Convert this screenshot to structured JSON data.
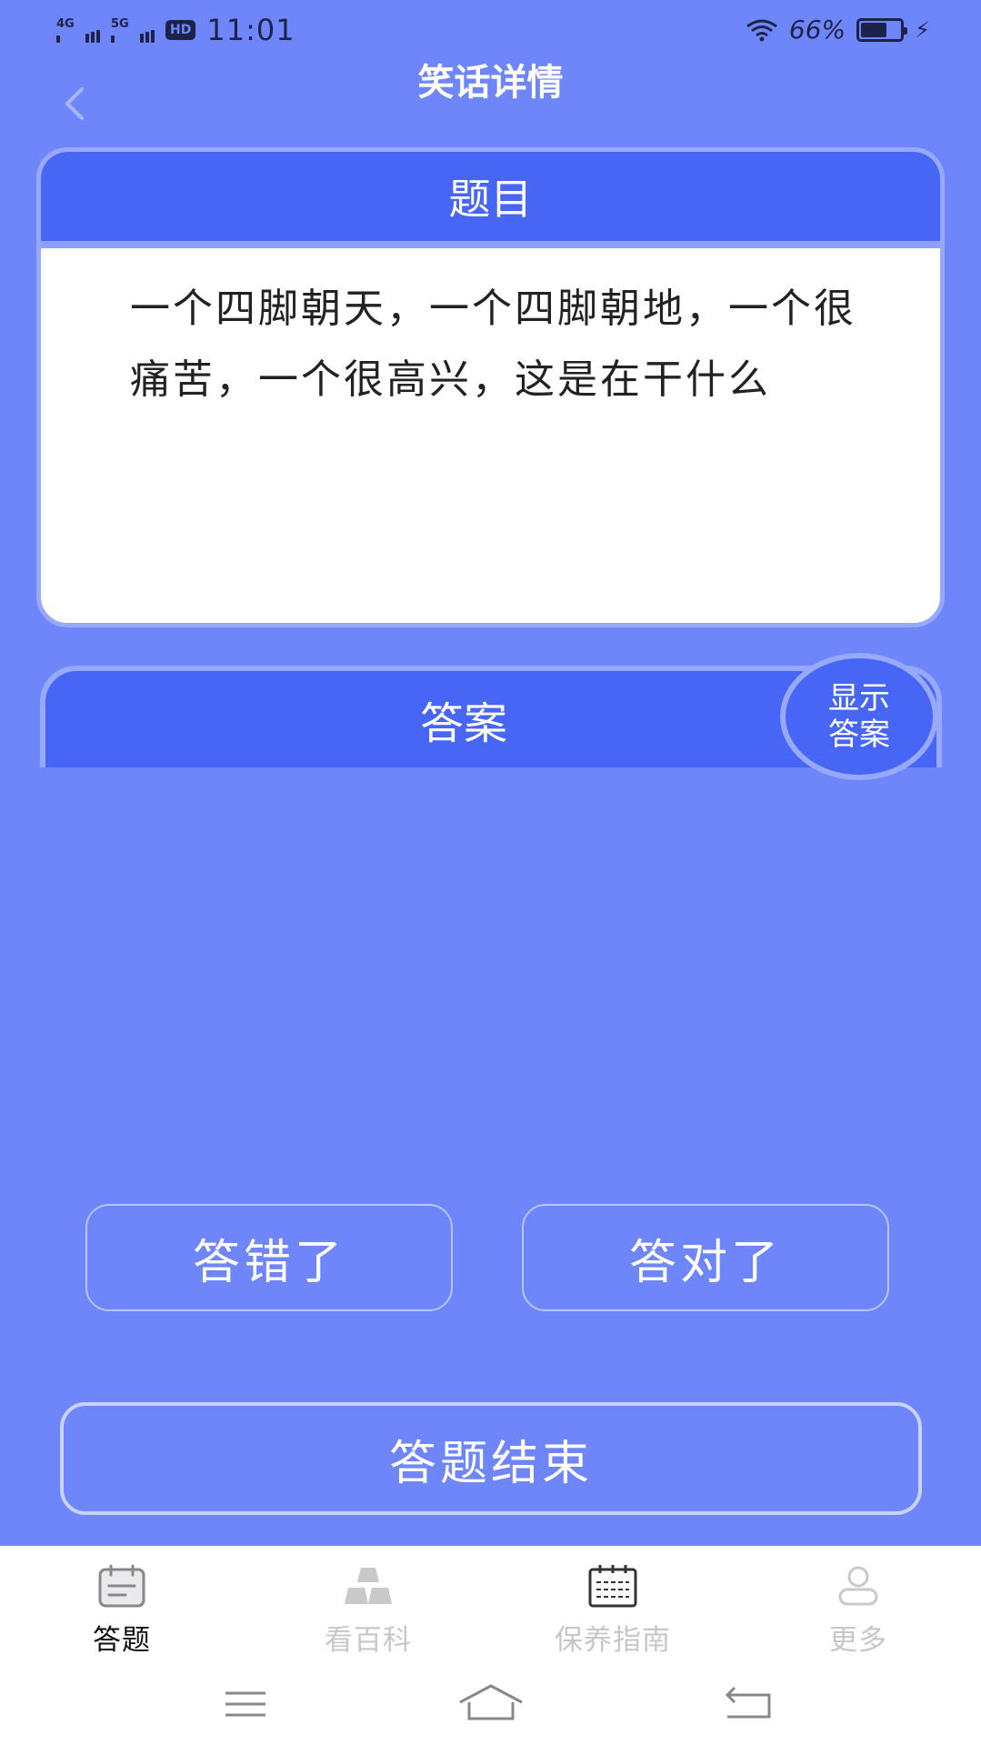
{
  "status_bar": {
    "signal1": "4G",
    "signal2": "5G",
    "hd": "HD",
    "time": "11:01",
    "battery_percent": "66%",
    "battery_level": 0.66
  },
  "header": {
    "title": "笑话详情"
  },
  "question": {
    "header": "题目",
    "text": "一个四脚朝天，一个四脚朝地，一个很痛苦，一个很高兴，这是在干什么"
  },
  "answer": {
    "header": "答案",
    "reveal_line1": "显示",
    "reveal_line2": "答案"
  },
  "actions": {
    "wrong": "答错了",
    "right": "答对了",
    "finish": "答题结束"
  },
  "tabs": [
    {
      "label": "答题",
      "icon": "calendar-icon",
      "active": true
    },
    {
      "label": "看百科",
      "icon": "gold-bars-icon",
      "active": false
    },
    {
      "label": "保养指南",
      "icon": "grid-calendar-icon",
      "active": false
    },
    {
      "label": "更多",
      "icon": "user-icon",
      "active": false
    }
  ],
  "colors": {
    "background": "#6f86fb",
    "header_blue": "#4866f5",
    "border_light": "#97a9ff"
  }
}
